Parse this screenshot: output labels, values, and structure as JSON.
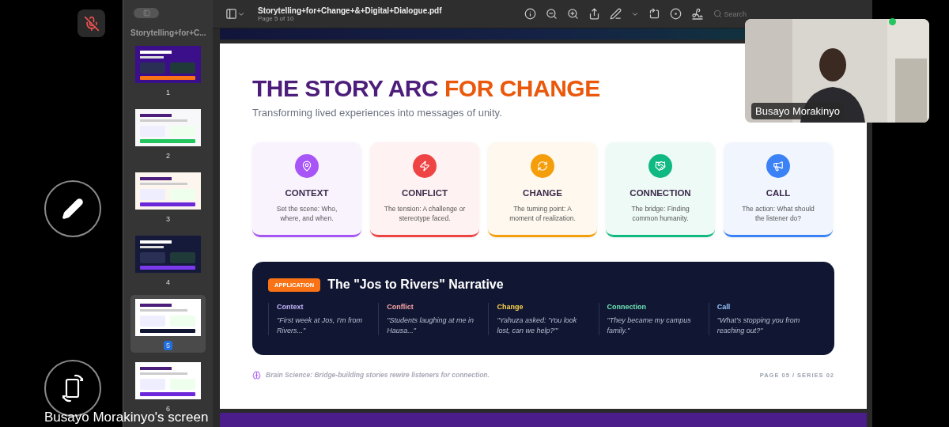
{
  "call": {
    "mic_muted": true,
    "screen_label": "Busayo Morakinyo's screen"
  },
  "participant": {
    "name": "Busayo Morakinyo"
  },
  "viewer": {
    "sidebar_title": "Storytelling+for+C...",
    "file_name": "Storytelling+for+Change+&+Digital+Dialogue.pdf",
    "page_info": "Page 5 of 10",
    "search_placeholder": "Search",
    "thumbnails": [
      {
        "label": "1",
        "selected": false
      },
      {
        "label": "2",
        "selected": false
      },
      {
        "label": "3",
        "selected": false
      },
      {
        "label": "4",
        "selected": false
      },
      {
        "label": "5",
        "selected": true
      },
      {
        "label": "6",
        "selected": false
      }
    ]
  },
  "slide": {
    "title_main": "THE STORY ARC",
    "title_accent": "FOR CHANGE",
    "subtitle": "Transforming lived experiences into messages of unity.",
    "stages": [
      {
        "kind": "pin",
        "title": "CONTEXT",
        "text": "Set the scene: Who, where, and when.",
        "color": "#a855f7"
      },
      {
        "kind": "bolt",
        "title": "CONFLICT",
        "text": "The tension: A challenge or stereotype faced.",
        "color": "#ef4444"
      },
      {
        "kind": "cycle",
        "title": "CHANGE",
        "text": "The turning point: A moment of realization.",
        "color": "#f59e0b"
      },
      {
        "kind": "handshake",
        "title": "CONNECTION",
        "text": "The bridge: Finding common humanity.",
        "color": "#10b981"
      },
      {
        "kind": "megaphone",
        "title": "CALL",
        "text": "The action: What should the listener do?",
        "color": "#3b82f6"
      }
    ],
    "application": {
      "badge": "APPLICATION",
      "title": "The \"Jos to Rivers\" Narrative",
      "beats": [
        {
          "label": "Context",
          "quote": "\"First week at Jos, I'm from Rivers...\"",
          "color": "#c4b5fd"
        },
        {
          "label": "Conflict",
          "quote": "\"Students laughing at me in Hausa...\"",
          "color": "#fca5a5"
        },
        {
          "label": "Change",
          "quote": "\"Yahuza asked: 'You look lost, can we help?'\"",
          "color": "#fcd34d"
        },
        {
          "label": "Connection",
          "quote": "\"They became my campus family.\"",
          "color": "#6ee7b7"
        },
        {
          "label": "Call",
          "quote": "\"What's stopping you from reaching out?\"",
          "color": "#93c5fd"
        }
      ]
    },
    "footer": {
      "note": "Brain Science: Bridge-building stories rewire listeners for connection.",
      "page": "PAGE 05 / SERIES 02"
    }
  }
}
